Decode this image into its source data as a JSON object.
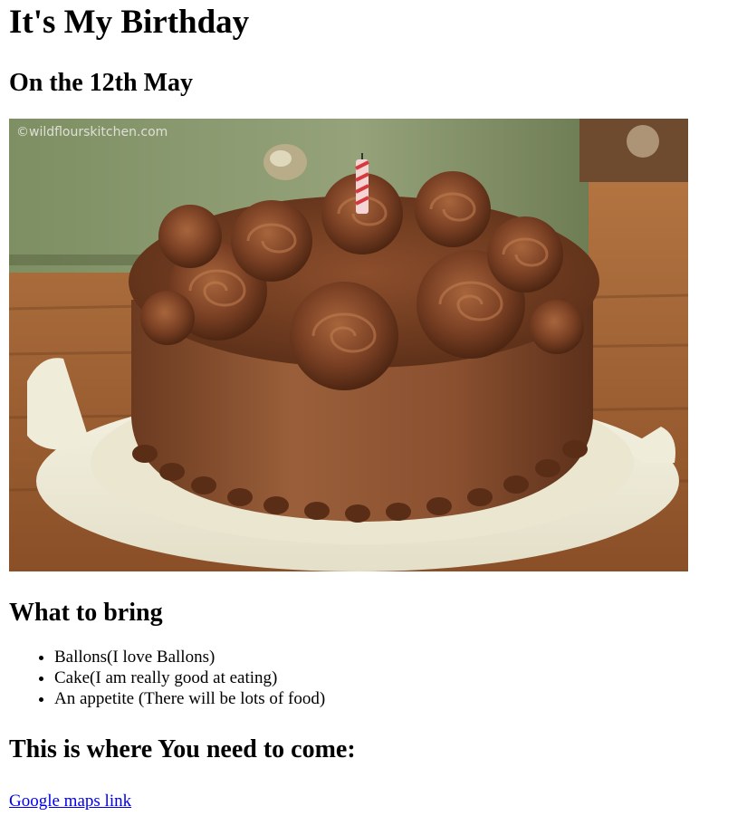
{
  "page": {
    "title": "It's My Birthday",
    "date": "On the 12th May"
  },
  "photo": {
    "watermark": "©wildflourskitchen.com",
    "subject": "chocolate-birthday-cake"
  },
  "bring": {
    "heading": "What to bring",
    "items": [
      "Ballons(I love Ballons)",
      "Cake(I am really good at eating)",
      "An appetite (There will be lots of food)"
    ]
  },
  "location": {
    "heading": "This is where You need to come:",
    "link_label": "Google maps link"
  },
  "colors": {
    "link": "#0000ee",
    "frosting": "#7a4326",
    "table": "#a86a3c",
    "cabinet": "#8a9a6e"
  }
}
